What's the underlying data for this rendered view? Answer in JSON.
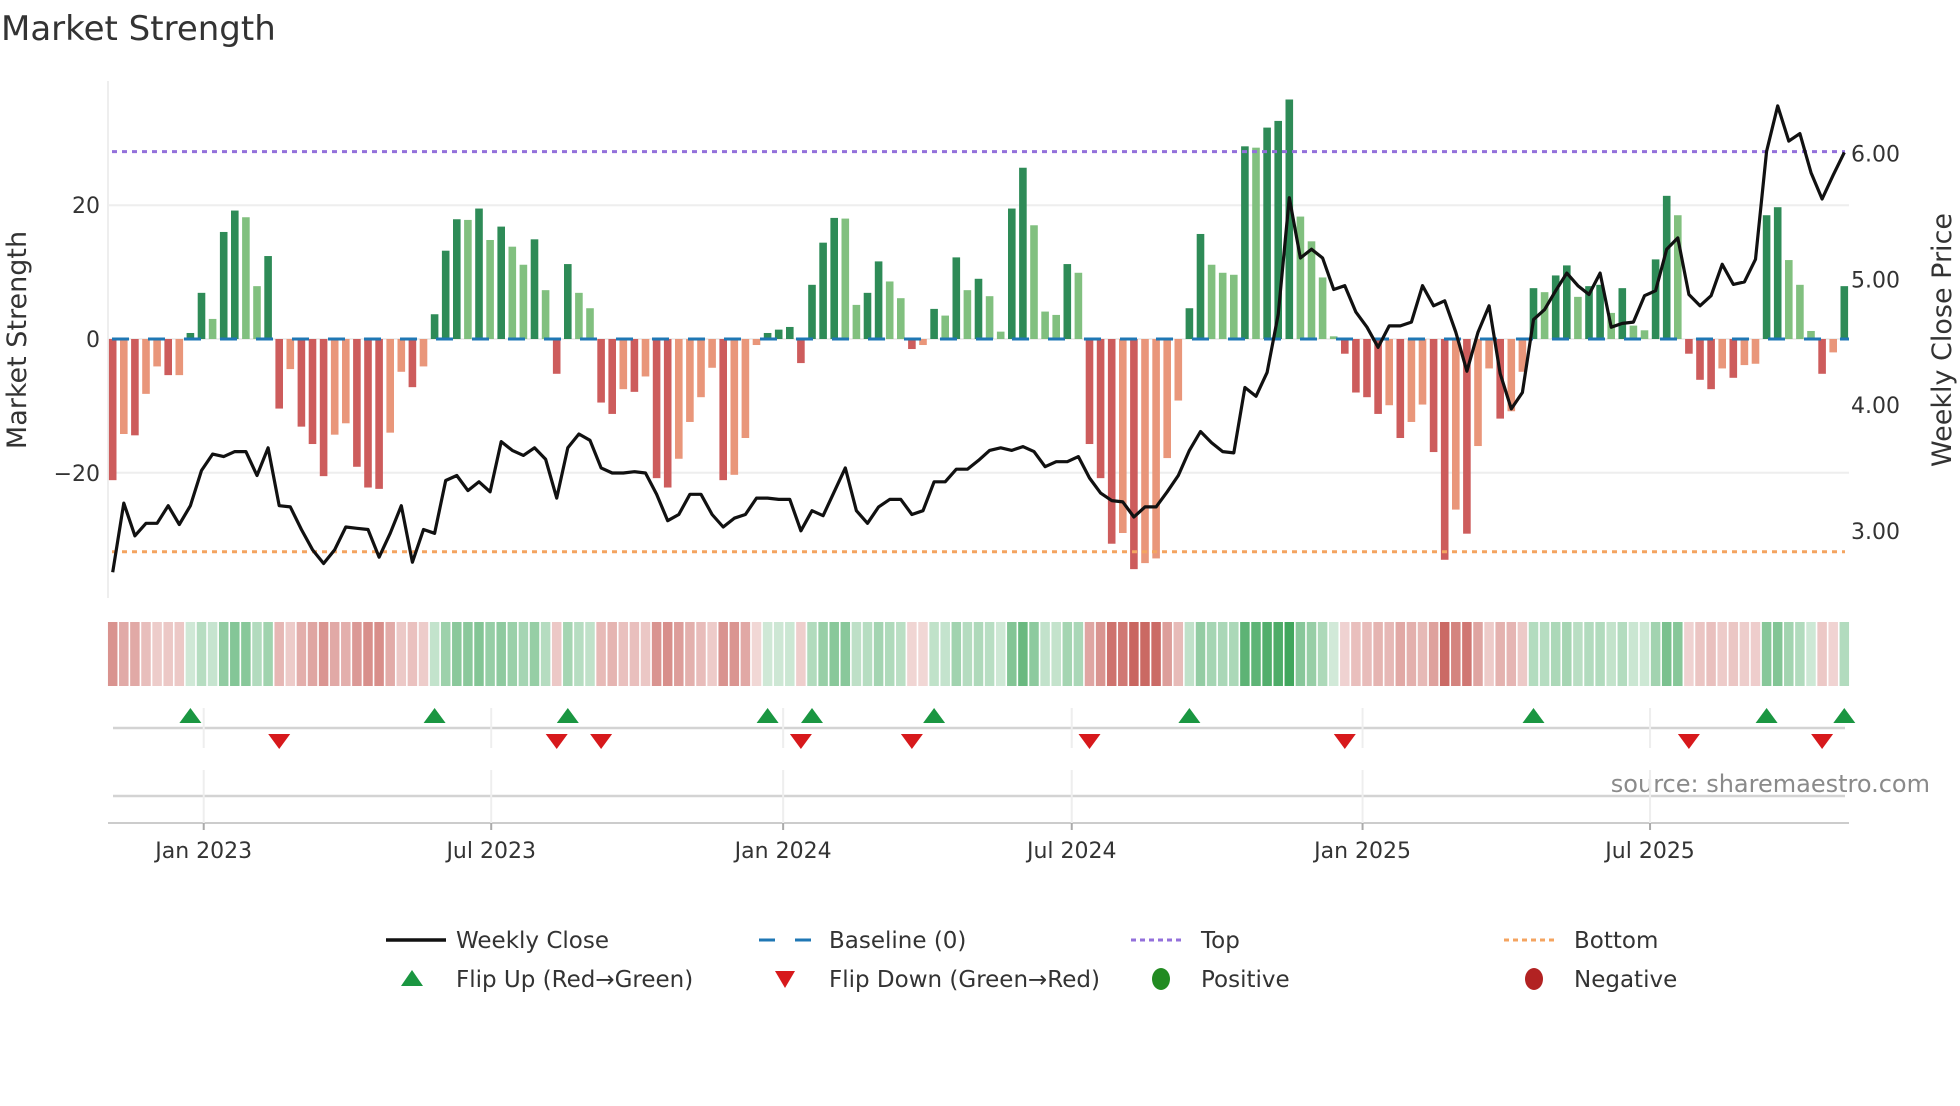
{
  "chart_data": {
    "type": "bar",
    "title": "Market Strength",
    "ylabel": "Market Strength",
    "y2label": "Weekly Close Price",
    "source": "source: sharemaestro.com",
    "ylim": [
      -38.7,
      38.6
    ],
    "y2lim": [
      2.47,
      6.58
    ],
    "yticks": [
      {
        "value": 20,
        "label": "20"
      },
      {
        "value": 0,
        "label": "0"
      },
      {
        "value": -20,
        "label": "−20"
      }
    ],
    "y2ticks": [
      {
        "value": 6,
        "label": "6.00"
      },
      {
        "value": 5,
        "label": "5.00"
      },
      {
        "value": 4,
        "label": "4.00"
      },
      {
        "value": 3,
        "label": "3.00"
      }
    ],
    "x_unit": "week index",
    "xticks": [
      {
        "week": 8.2,
        "label": "Jan 2023"
      },
      {
        "week": 34.1,
        "label": "Jul 2023"
      },
      {
        "week": 60.4,
        "label": "Jan 2024"
      },
      {
        "week": 86.4,
        "label": "Jul 2024"
      },
      {
        "week": 112.6,
        "label": "Jan 2025"
      },
      {
        "week": 138.5,
        "label": "Jul 2025"
      }
    ],
    "top_level": 28.0,
    "bottom_level": -31.8,
    "baseline": 0,
    "series": [
      {
        "name": "Market Strength",
        "values": [
          -21.1,
          -14.2,
          -14.4,
          -8.2,
          -4.1,
          -5.4,
          -5.4,
          0.9,
          6.9,
          3.0,
          16.0,
          19.2,
          18.2,
          7.9,
          12.4,
          -10.4,
          -4.5,
          -13.1,
          -15.7,
          -20.5,
          -14.3,
          -12.6,
          -19.1,
          -22.2,
          -22.4,
          -14.0,
          -4.9,
          -7.2,
          -4.1,
          3.7,
          13.2,
          17.9,
          17.8,
          19.5,
          14.8,
          16.8,
          13.8,
          11.1,
          14.9,
          7.3,
          -5.2,
          11.2,
          6.9,
          4.6,
          -9.5,
          -11.2,
          -7.5,
          -7.9,
          -5.6,
          -20.8,
          -22.2,
          -17.9,
          -12.4,
          -8.7,
          -4.3,
          -21.1,
          -20.3,
          -14.8,
          -0.9,
          0.9,
          1.4,
          1.8,
          -3.6,
          8.1,
          14.4,
          18.1,
          18.0,
          5.1,
          6.9,
          11.6,
          8.6,
          6.1,
          -1.5,
          -0.9,
          4.5,
          3.5,
          12.2,
          7.3,
          9.0,
          6.4,
          1.1,
          19.5,
          25.6,
          17.0,
          4.1,
          3.6,
          11.2,
          9.9,
          -15.7,
          -20.8,
          -30.6,
          -29.0,
          -34.4,
          -33.5,
          -32.8,
          -17.8,
          -9.2,
          4.6,
          15.7,
          11.1,
          9.9,
          9.6,
          28.8,
          28.6,
          31.6,
          32.6,
          35.8,
          18.3,
          14.6,
          9.2,
          0.4,
          -2.2,
          -8.0,
          -8.7,
          -11.2,
          -9.9,
          -14.8,
          -12.4,
          -9.8,
          -16.9,
          -33.0,
          -25.5,
          -29.1,
          -16.0,
          -4.4,
          -11.9,
          -10.8,
          -4.9,
          7.6,
          7.0,
          9.5,
          11.0,
          6.3,
          7.9,
          8.1,
          3.9,
          7.6,
          2.0,
          1.3,
          11.9,
          21.4,
          18.5,
          -2.2,
          -6.1,
          -7.5,
          -4.4,
          -5.8,
          -3.9,
          -3.7,
          18.5,
          19.7,
          11.8,
          8.1,
          1.2,
          -5.2,
          -2.0,
          7.9
        ]
      },
      {
        "name": "Weekly Close",
        "axis": "right",
        "values": [
          2.67,
          3.22,
          2.96,
          3.06,
          3.06,
          3.2,
          3.05,
          3.2,
          3.48,
          3.61,
          3.59,
          3.63,
          3.63,
          3.44,
          3.66,
          3.2,
          3.19,
          3.01,
          2.85,
          2.74,
          2.85,
          3.03,
          3.02,
          3.01,
          2.79,
          2.98,
          3.2,
          2.75,
          3.01,
          2.98,
          3.4,
          3.44,
          3.32,
          3.39,
          3.31,
          3.71,
          3.64,
          3.6,
          3.66,
          3.57,
          3.26,
          3.66,
          3.77,
          3.72,
          3.5,
          3.46,
          3.46,
          3.47,
          3.46,
          3.29,
          3.08,
          3.13,
          3.29,
          3.29,
          3.13,
          3.03,
          3.1,
          3.13,
          3.26,
          3.26,
          3.25,
          3.25,
          3.0,
          3.16,
          3.12,
          3.31,
          3.5,
          3.16,
          3.06,
          3.19,
          3.25,
          3.25,
          3.13,
          3.16,
          3.39,
          3.39,
          3.49,
          3.49,
          3.56,
          3.64,
          3.66,
          3.64,
          3.67,
          3.63,
          3.51,
          3.55,
          3.55,
          3.59,
          3.42,
          3.3,
          3.24,
          3.23,
          3.11,
          3.19,
          3.19,
          3.31,
          3.44,
          3.64,
          3.79,
          3.7,
          3.63,
          3.62,
          4.14,
          4.07,
          4.26,
          4.72,
          5.65,
          5.17,
          5.24,
          5.17,
          4.92,
          4.95,
          4.74,
          4.62,
          4.46,
          4.63,
          4.63,
          4.66,
          4.95,
          4.79,
          4.83,
          4.58,
          4.27,
          4.58,
          4.79,
          4.25,
          3.97,
          4.1,
          4.68,
          4.76,
          4.91,
          5.05,
          4.95,
          4.88,
          5.05,
          4.62,
          4.65,
          4.66,
          4.87,
          4.91,
          5.24,
          5.33,
          4.88,
          4.79,
          4.87,
          5.12,
          4.96,
          4.98,
          5.16,
          6.02,
          6.38,
          6.1,
          6.16,
          5.85,
          5.64,
          5.83,
          6.01
        ]
      }
    ],
    "legend": {
      "placement": "bottom",
      "items": [
        {
          "label": "Weekly Close",
          "symbol": "line"
        },
        {
          "label": "Baseline (0)",
          "symbol": "dash"
        },
        {
          "label": "Top",
          "symbol": "dot-purple"
        },
        {
          "label": "Bottom",
          "symbol": "dot-orange"
        },
        {
          "label": "Flip Up (Red→Green)",
          "symbol": "triangle-up"
        },
        {
          "label": "Flip Down (Green→Red)",
          "symbol": "triangle-down"
        },
        {
          "label": "Positive",
          "symbol": "circle-green"
        },
        {
          "label": "Negative",
          "symbol": "circle-red"
        }
      ]
    },
    "colors": {
      "pos_strong": "#2e8b57",
      "pos_weak": "#81c07f",
      "neg_strong": "#cd5c5c",
      "neg_weak": "#e9967a",
      "baseline": "#1f77b4",
      "top": "#9370db",
      "bottom": "#f4a460",
      "flip_up": "#1a9641",
      "flip_down": "#d7191c",
      "positive": "#228b22",
      "negative": "#b22222",
      "close": "#111111"
    }
  }
}
